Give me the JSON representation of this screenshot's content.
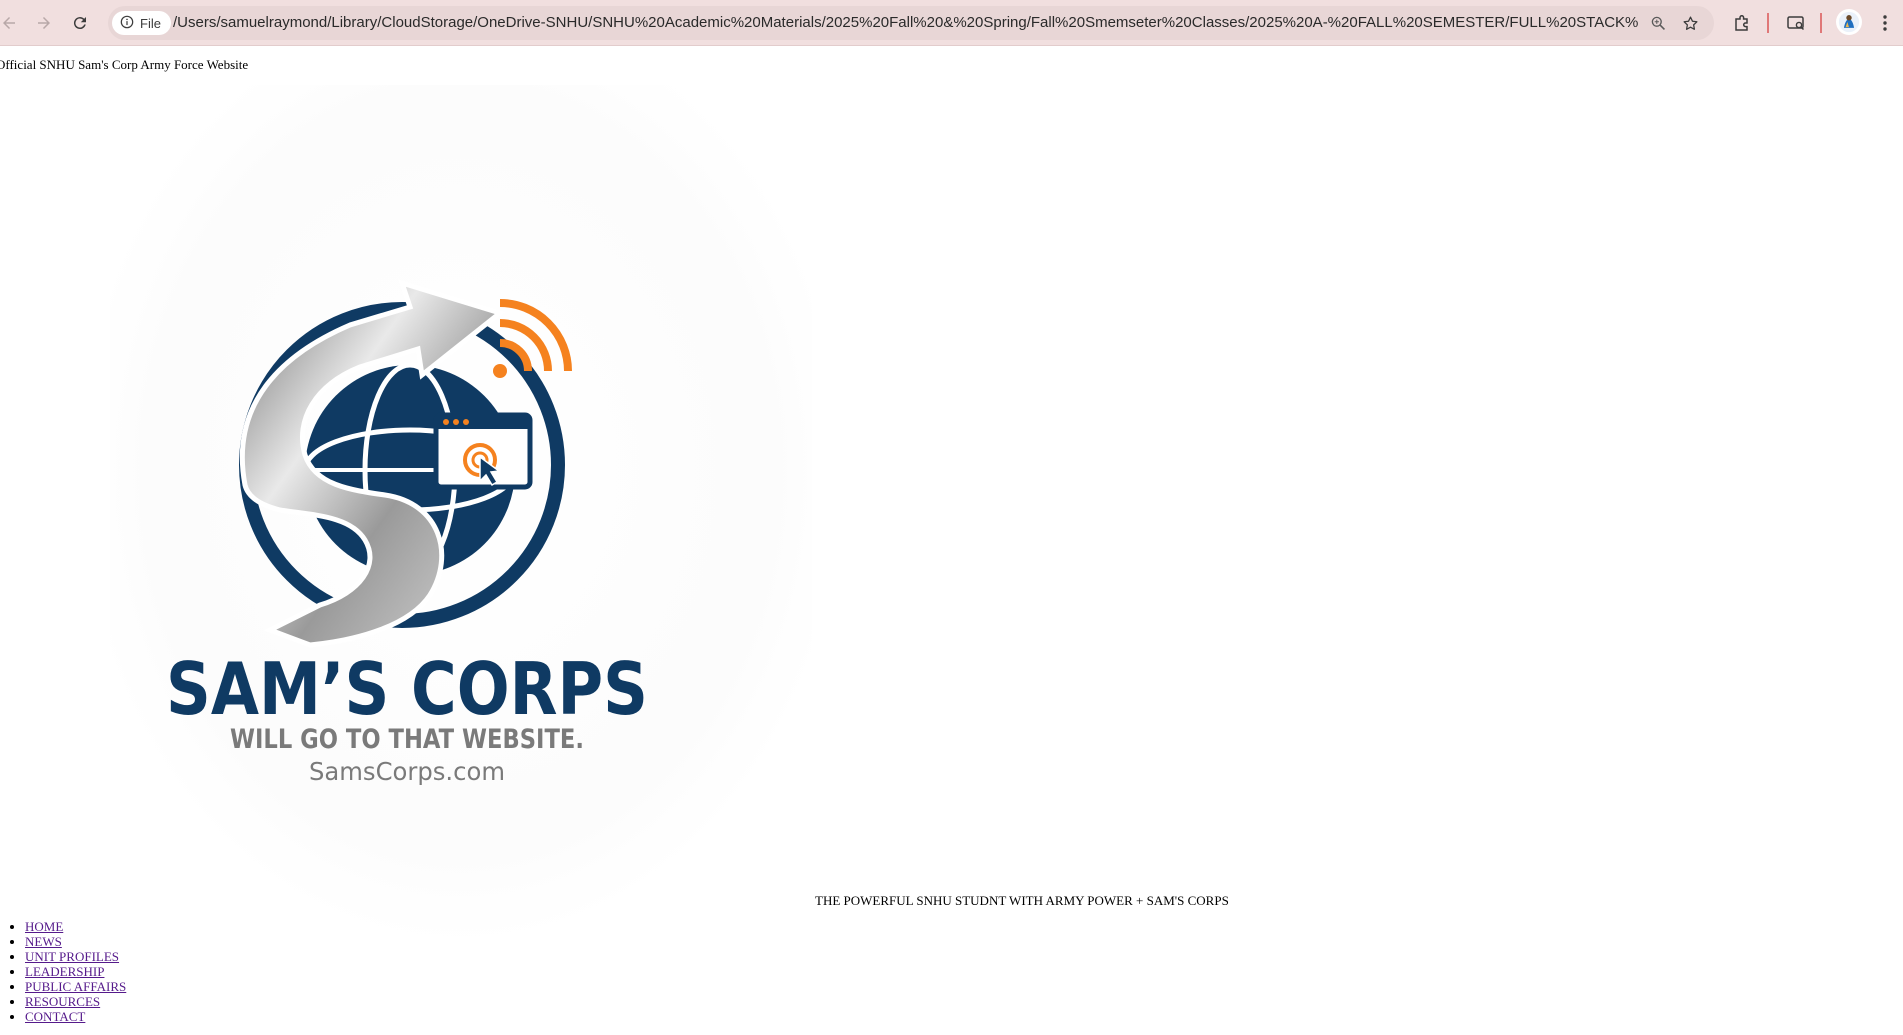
{
  "browser": {
    "file_chip_label": "File",
    "url": "/Users/samuelraymond/Library/CloudStorage/OneDrive-SNHU/SNHU%20Academic%20Materials/2025%20Fall%20&%20Spring/Fall%20Smemseter%20Classes/2025%20A-%20FALL%20SEMESTER/FULL%20STACK%20...",
    "icons": [
      "back-arrow-icon",
      "forward-arrow-icon",
      "reload-icon",
      "info-icon",
      "zoom-icon",
      "star-icon",
      "extensions-icon",
      "tab-search-icon",
      "profile-avatar",
      "more-menu-icon"
    ]
  },
  "page": {
    "site_heading": "Official SNHU Sam's Corp Army Force Website",
    "logo": {
      "title": "SAM’S CORPS",
      "subtitle": "WILL GO TO THAT WEBSITE.",
      "domain": "SamsCorps.com"
    },
    "tagline": "THE POWERFUL SNHU STUDNT WITH ARMY POWER + SAM'S CORPS",
    "nav": [
      "HOME",
      "NEWS",
      "UNIT PROFILES",
      "LEADERSHIP",
      "PUBLIC AFFAIRS",
      "RESOURCES",
      "CONTACT"
    ]
  },
  "colors": {
    "chrome_bg": "#f1dfdf",
    "navy": "#0f3a63",
    "orange": "#f5821f",
    "gray_text": "#7a7a7a",
    "visited_link": "#551a8b"
  }
}
